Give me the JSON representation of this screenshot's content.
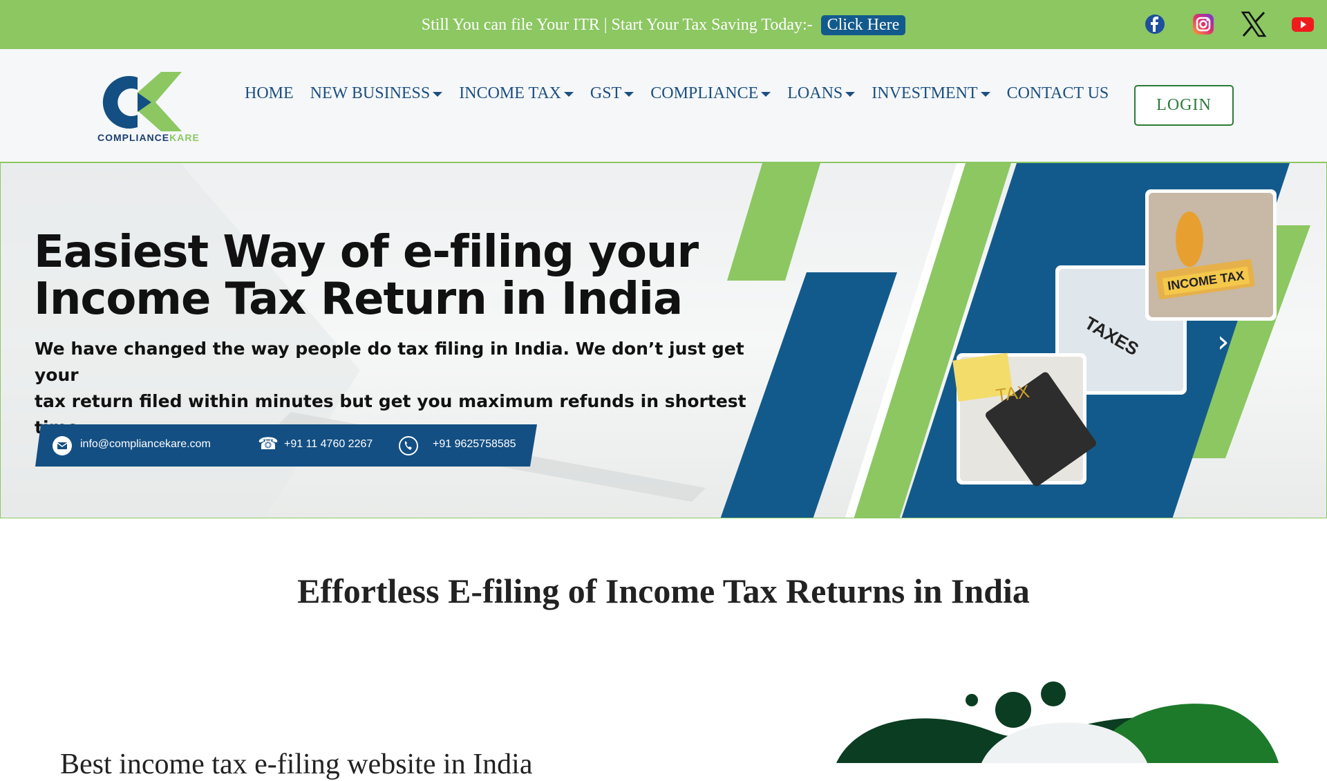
{
  "topbar": {
    "message": "Still You can file Your ITR | Start Your Tax Saving Today:-",
    "cta_label": "Click Here",
    "social": [
      "facebook-icon",
      "instagram-icon",
      "x-icon",
      "youtube-icon"
    ]
  },
  "brand": {
    "name_main": "COMPLIANCE",
    "name_accent": "KARE"
  },
  "nav": {
    "items": [
      {
        "label": "HOME",
        "dropdown": false
      },
      {
        "label": "NEW BUSINESS",
        "dropdown": true
      },
      {
        "label": "INCOME TAX",
        "dropdown": true
      },
      {
        "label": "GST",
        "dropdown": true
      },
      {
        "label": "COMPLIANCE",
        "dropdown": true
      },
      {
        "label": "LOANS",
        "dropdown": true
      },
      {
        "label": "INVESTMENT",
        "dropdown": true
      },
      {
        "label": "CONTACT US",
        "dropdown": false
      }
    ],
    "login_label": "LOGIN"
  },
  "hero": {
    "headline_1": "Easiest Way of e-filing your",
    "headline_2": "Income Tax Return in India",
    "body_1": "We have changed the way people do tax filing in India. We don’t just get your",
    "body_2": "tax return filed within minutes but get you maximum refunds in shortest time.",
    "email": "info@compliancekare.com",
    "phone_1": "+91 11 4760 2267",
    "phone_2": "+91 9625758585",
    "image_labels": [
      "TAX",
      "TAXES",
      "INCOME TAX"
    ],
    "next_arrow": "›"
  },
  "section": {
    "title": "Effortless E-filing of Income Tax Returns in India",
    "partial_text": "Best income tax e-filing website in India"
  },
  "colors": {
    "green": "#8cc762",
    "blue": "#135a8c",
    "dark_green": "#0b3d22"
  }
}
